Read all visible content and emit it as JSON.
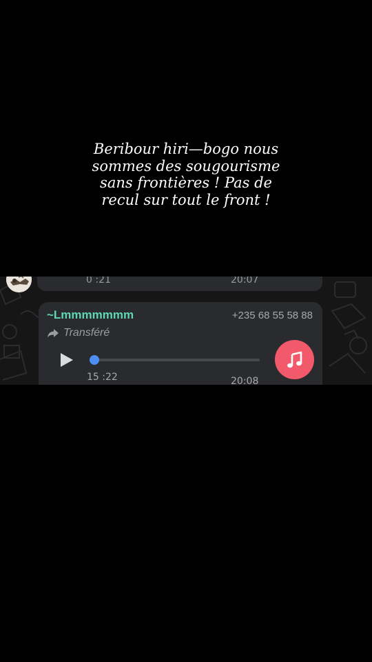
{
  "caption": {
    "line1": "Beribour hiri—bogo nous",
    "line2": "sommes des sougourisme",
    "line3": "sans frontières ! Pas de",
    "line4": "recul sur tout le front !"
  },
  "previous_message": {
    "duration": "0 :21",
    "time": "20:07"
  },
  "message": {
    "sender_name": "~Lmmmmmmm",
    "sender_phone": "+235 68 55 58 88",
    "forwarded_label": "Transféré",
    "duration": "15 :22",
    "time": "20:08",
    "progress": 0.03
  },
  "icons": {
    "play": "play-icon",
    "forward": "forward-arrow-icon",
    "music": "music-note-icon"
  },
  "colors": {
    "sender_name": "#5fd7b4",
    "progress": "#4d8ef2",
    "music_badge": "#f25a6c",
    "bubble": "#2a2b2e"
  }
}
